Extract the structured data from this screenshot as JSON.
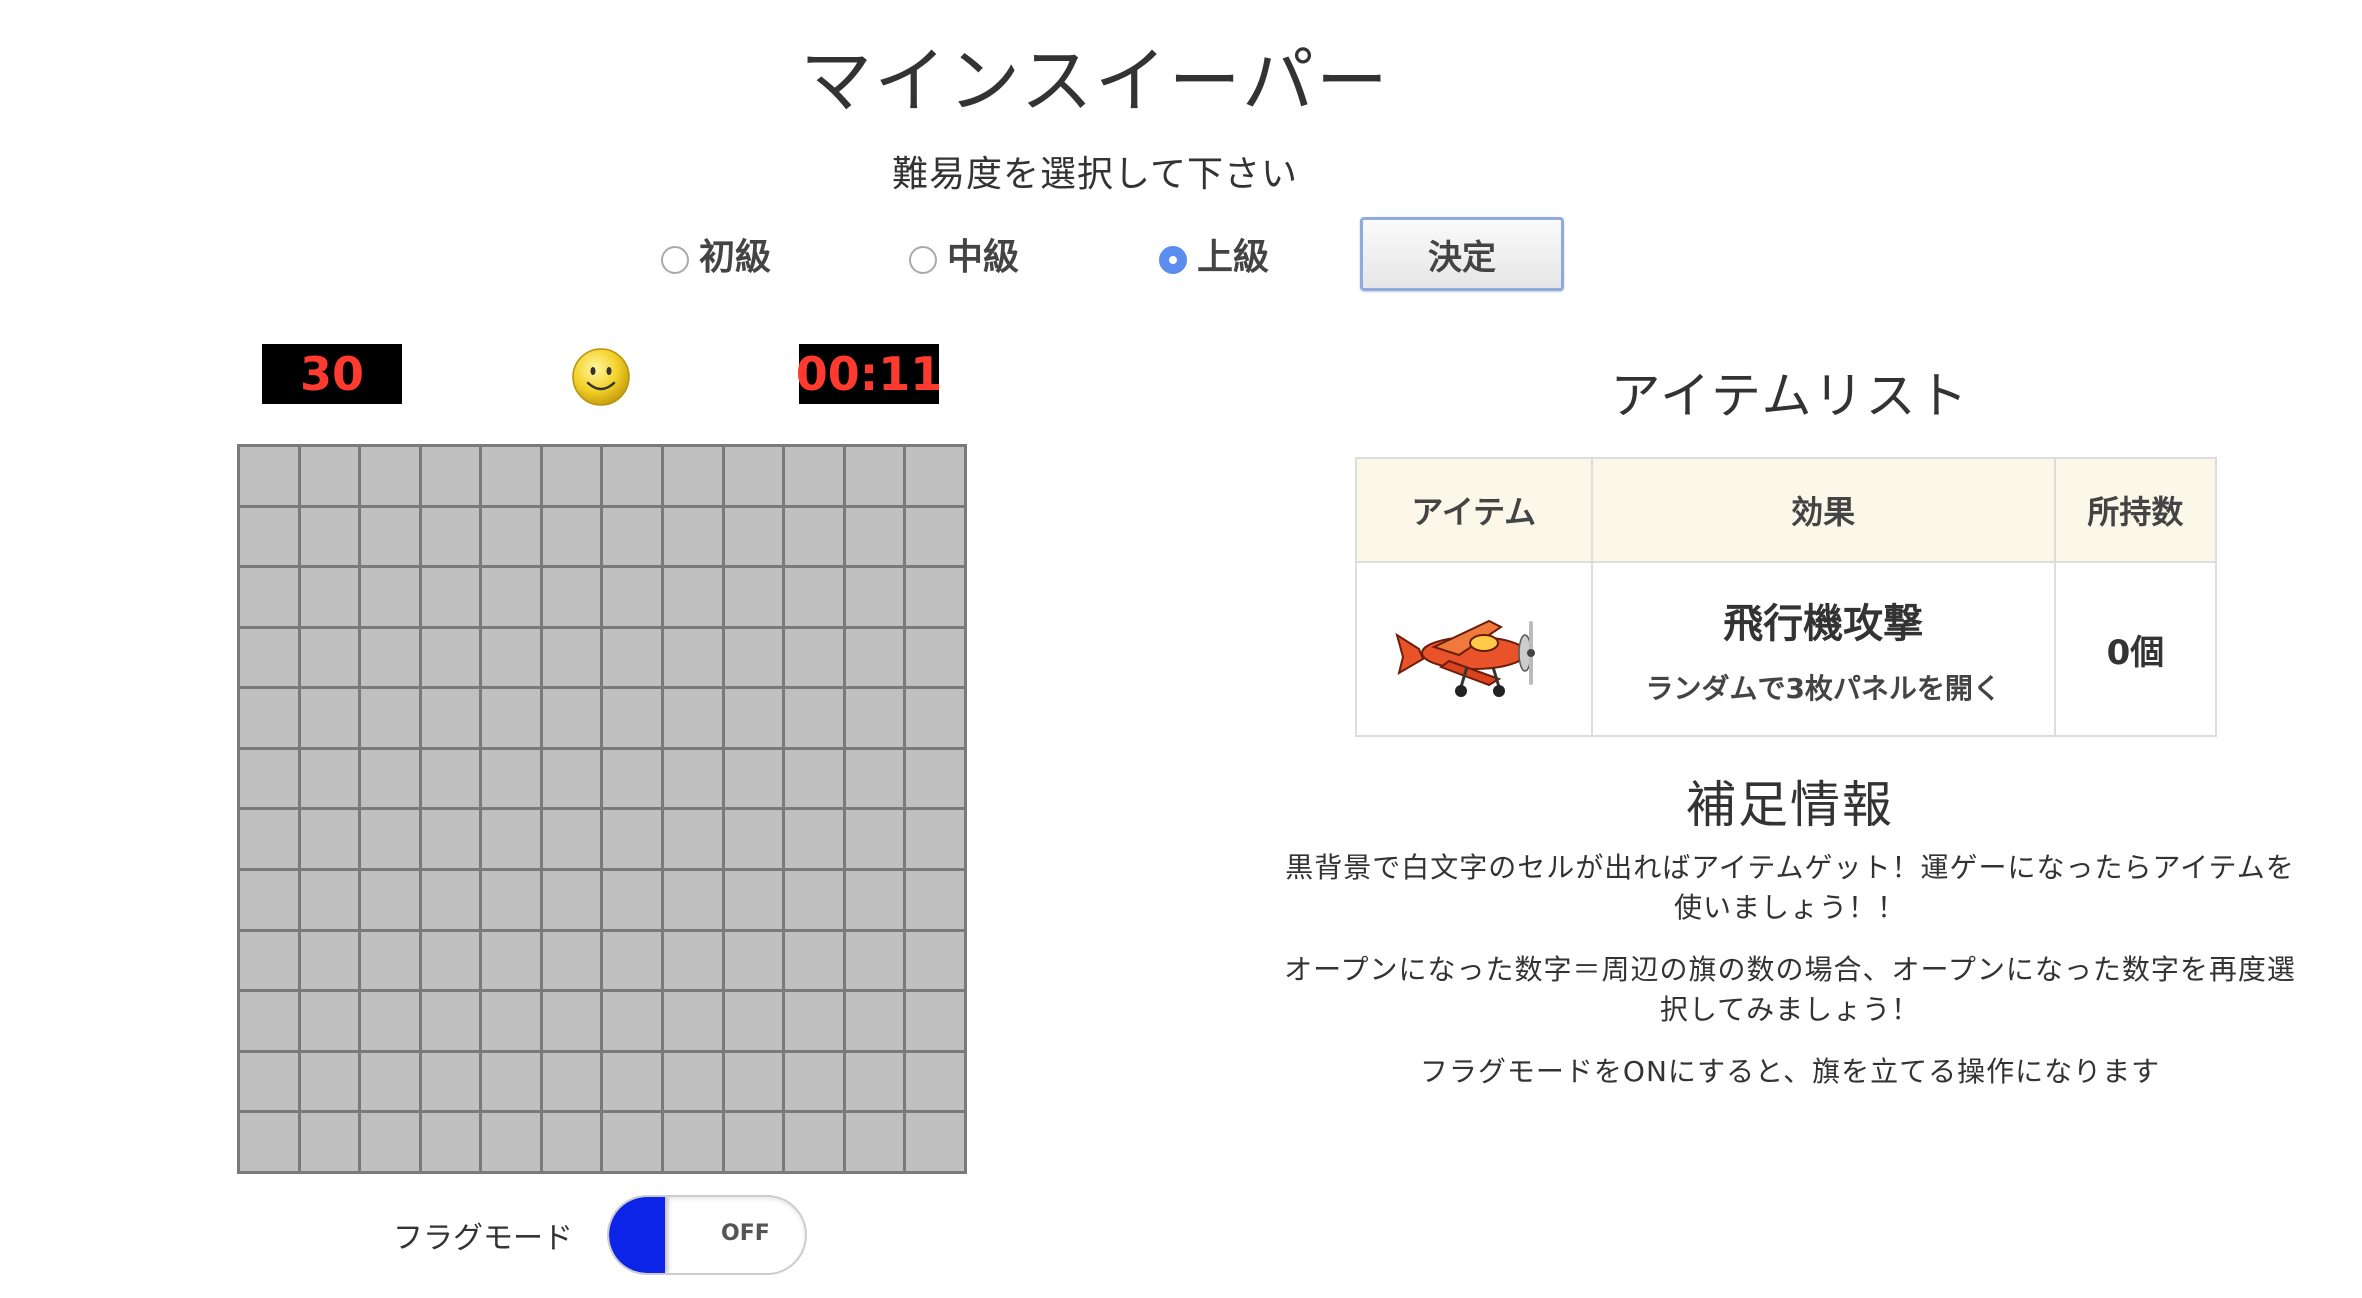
{
  "title": "マインスイーパー",
  "difficulty": {
    "prompt": "難易度を選択して下さい",
    "options": [
      {
        "label": "初級",
        "checked": false
      },
      {
        "label": "中級",
        "checked": false
      },
      {
        "label": "上級",
        "checked": true
      }
    ],
    "submit_label": "決定"
  },
  "status": {
    "mines_remaining": "30",
    "face_icon": "smiley-face-icon",
    "timer": "00:11"
  },
  "board": {
    "rows": 12,
    "cols": 12
  },
  "flag_mode": {
    "label": "フラグモード",
    "state": "OFF",
    "knob_color": "#0b24e8"
  },
  "items": {
    "title": "アイテムリスト",
    "headers": [
      "アイテム",
      "効果",
      "所持数"
    ],
    "rows": [
      {
        "icon": "airplane-icon",
        "effect_name": "飛行機攻撃",
        "effect_desc": "ランダムで3枚パネルを開く",
        "count": "0個"
      }
    ]
  },
  "info": {
    "title": "補足情報",
    "paragraphs": [
      [
        "黒背景で白文字のセルが出ればアイテムゲット！運ゲーになったらアイテムを",
        "使いましょう！！"
      ],
      [
        "オープンになった数字＝周辺の旗の数の場合、オープンになった数字を再度選",
        "択してみましょう！"
      ],
      [
        "フラグモードをONにすると、旗を立てる操作になります"
      ]
    ]
  },
  "colors": {
    "lcd_text": "#ff3b2f",
    "lcd_bg": "#000000",
    "cell": "#c0c0c0",
    "header_bg": "#fbf8e9",
    "radio_checked": "#5b8def"
  }
}
